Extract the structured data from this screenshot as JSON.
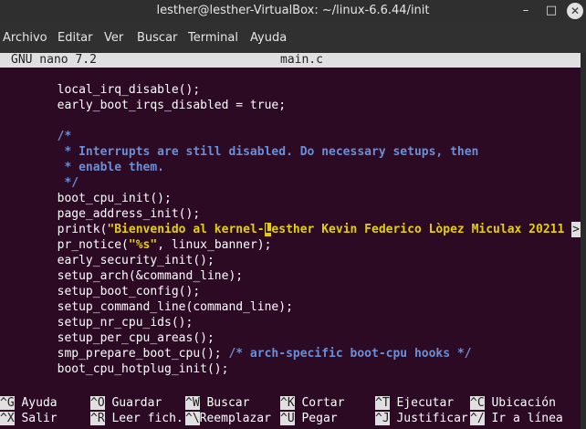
{
  "window": {
    "title": "lesther@lesther-VirtualBox: ~/linux-6.6.44/init",
    "minimize_glyph": "–",
    "maximize_glyph": "□",
    "close_glyph": "✕"
  },
  "menu": [
    "Archivo",
    "Editar",
    "Ver",
    "Buscar",
    "Terminal",
    "Ayuda"
  ],
  "nano": {
    "version": "GNU nano 7.2",
    "filename": "main.c",
    "overflow_marker": ">"
  },
  "code": {
    "l1": "        local_irq_disable();",
    "l2": "        early_boot_irqs_disabled = true;",
    "l4": "        /*",
    "l5": "         * Interrupts are still disabled. Do necessary setups, then",
    "l6": "         * enable them.",
    "l7": "         */",
    "l8": "        boot_cpu_init();",
    "l9": "        page_address_init();",
    "l10a": "        printk(",
    "l10b": "\"Bienvenido al kernel-",
    "l10c": "L",
    "l10d": "esther Kevin Federico Lòpez Miculax 20211",
    "l11a": "        pr_notice(",
    "l11b": "\"%s\"",
    "l11c": ", linux_banner);",
    "l12": "        early_security_init();",
    "l13": "        setup_arch(&command_line);",
    "l14": "        setup_boot_config();",
    "l15": "        setup_command_line(command_line);",
    "l16": "        setup_nr_cpu_ids();",
    "l17": "        setup_per_cpu_areas();",
    "l18a": "        smp_prepare_boot_cpu(); ",
    "l18b": "/* arch-specific boot-cpu hooks */",
    "l19": "        boot_cpu_hotplug_init();"
  },
  "shortcuts": [
    {
      "key": "^G",
      "label": "Ayuda"
    },
    {
      "key": "^O",
      "label": "Guardar"
    },
    {
      "key": "^W",
      "label": "Buscar"
    },
    {
      "key": "^K",
      "label": "Cortar"
    },
    {
      "key": "^T",
      "label": "Ejecutar"
    },
    {
      "key": "^C",
      "label": "Ubicación"
    },
    {
      "key": "^X",
      "label": "Salir"
    },
    {
      "key": "^R",
      "label": "Leer fich."
    },
    {
      "key": "^\\",
      "label": "Reemplazar"
    },
    {
      "key": "^U",
      "label": "Pegar"
    },
    {
      "key": "^J",
      "label": "Justificar"
    },
    {
      "key": "^/",
      "label": "Ir a línea"
    }
  ]
}
